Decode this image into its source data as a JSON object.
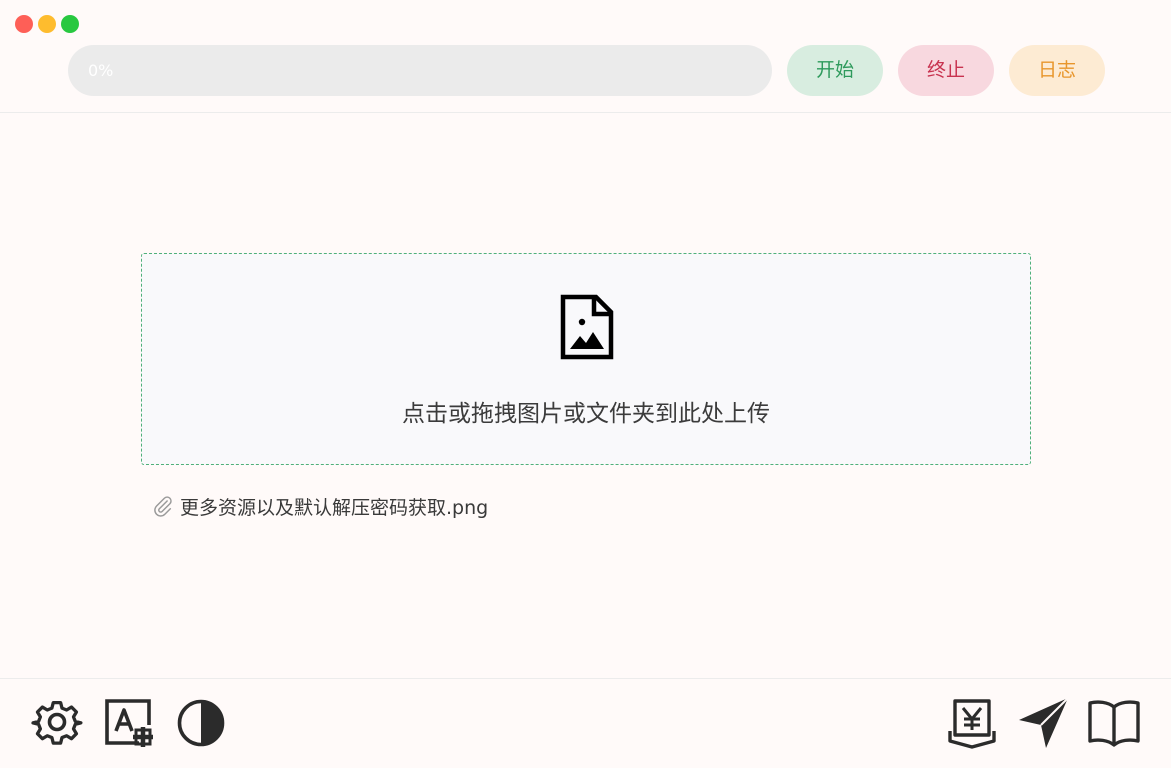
{
  "window": {
    "controls": [
      "close",
      "minimize",
      "maximize"
    ]
  },
  "header": {
    "progress": {
      "value": 0,
      "label": "0%"
    },
    "buttons": {
      "start": "开始",
      "stop": "终止",
      "log": "日志"
    }
  },
  "upload": {
    "icon": "file-image-icon",
    "text": "点击或拖拽图片或文件夹到此处上传"
  },
  "files": [
    {
      "icon": "paperclip-icon",
      "name": "更多资源以及默认解压密码获取.png"
    }
  ],
  "footer": {
    "left_icons": [
      "gear-icon",
      "font-add-icon",
      "contrast-icon"
    ],
    "right_icons": [
      "yen-icon",
      "send-icon",
      "book-icon"
    ]
  },
  "colors": {
    "start_bg": "#d8ede0",
    "start_text": "#2e9a5c",
    "stop_bg": "#f8d8df",
    "stop_text": "#c8324f",
    "log_bg": "#fdebd3",
    "log_text": "#e8962c",
    "upload_border": "#4fb07a"
  }
}
